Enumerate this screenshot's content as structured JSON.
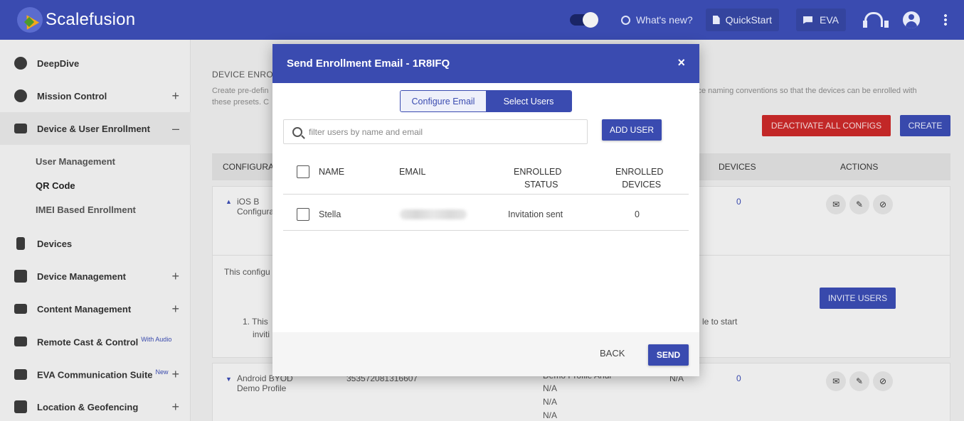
{
  "app": {
    "name": "Scalefusion"
  },
  "topbar": {
    "whats_new": "What's new?",
    "quickstart": "QuickStart",
    "eva": "EVA"
  },
  "sidebar": {
    "items": [
      {
        "label": "DeepDive"
      },
      {
        "label": "Mission Control"
      },
      {
        "label": "Device & User Enrollment"
      },
      {
        "label": "Devices"
      },
      {
        "label": "Device Management"
      },
      {
        "label": "Content Management"
      },
      {
        "label": "Remote Cast & Control",
        "badge": "With Audio"
      },
      {
        "label": "EVA Communication Suite",
        "badge": "New"
      },
      {
        "label": "Location & Geofencing"
      }
    ],
    "subitems": [
      {
        "label": "User Management"
      },
      {
        "label": "QR Code"
      },
      {
        "label": "IMEI Based Enrollment"
      }
    ],
    "plus": "+",
    "minus": "–"
  },
  "main": {
    "section_title": "DEVICE ENRO",
    "section_desc_left": "Create pre-defin",
    "section_desc_left2": "these presets. C",
    "section_desc_right": "ice naming conventions so that the devices can be enrolled with",
    "deactivate_label": "DEACTIVATE ALL CONFIGS",
    "create_label": "CREATE",
    "table_headers": {
      "config": "CONFIGURAT",
      "devices": "DEVICES",
      "actions": "ACTIONS"
    },
    "row1": {
      "name_a": "iOS B",
      "name_b": "Configura",
      "devices": "0"
    },
    "desc_text": "This configu",
    "step_text_a": "1. This",
    "step_text_b": "inviti",
    "step_text_right": "le to start",
    "invite_label": "INVITE USERS",
    "row2": {
      "name_a": "Android BYOD",
      "name_b": "Demo Profile",
      "code": "353572081316607",
      "profile_trunc": "Demo Profile Andr",
      "na1": "N/A",
      "na2": "N/A",
      "na3": "N/A",
      "col_na": "N/A",
      "devices": "0"
    }
  },
  "modal": {
    "title": "Send Enrollment Email - 1R8IFQ",
    "close": "×",
    "tabs": [
      {
        "label": "Configure Email",
        "active": false
      },
      {
        "label": "Select Users",
        "active": true
      }
    ],
    "search_placeholder": "filter users by name and email",
    "add_user_label": "ADD USER",
    "headers": {
      "name": "NAME",
      "email": "EMAIL",
      "enrolled_status_1": "ENROLLED",
      "enrolled_status_2": "STATUS",
      "enrolled_devices_1": "ENROLLED",
      "enrolled_devices_2": "DEVICES"
    },
    "rows": [
      {
        "name": "Stella",
        "status": "Invitation sent",
        "devices": "0"
      }
    ],
    "back_label": "BACK",
    "send_label": "SEND"
  },
  "colors": {
    "primary": "#3a4bb0",
    "danger": "#c62828"
  }
}
